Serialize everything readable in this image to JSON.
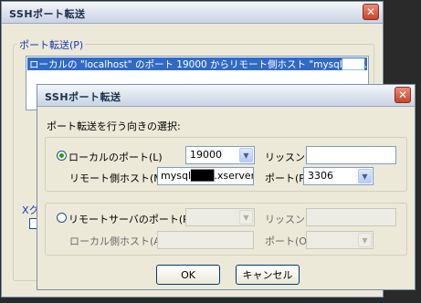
{
  "back_dialog": {
    "title": "SSHポート転送",
    "close_glyph": "✕",
    "group_label": "ポート転送(P)",
    "list_items": [
      "ローカルの \"localhost\" のポート 19000 からリモート側ホスト \"mysql███.xserver."
    ],
    "cropped_label": "Xク"
  },
  "dialog": {
    "title": "SSHポート転送",
    "close_glyph": "✕",
    "prompt": "ポート転送を行う向きの選択:",
    "local": {
      "radio_label": "ローカルのポート(L)",
      "port_value": "19000",
      "listen_label": "リッスン(I)",
      "listen_value": "",
      "remote_host_label": "リモート側ホスト(M)",
      "remote_host_value": "mysql███.xserver.jp",
      "port_label": "ポート(P)",
      "port_select_value": "3306"
    },
    "remote": {
      "radio_label": "リモートサーバのポート(R)",
      "port_value": "",
      "listen_label": "リッスン(S)",
      "listen_value": "",
      "local_host_label": "ローカル側ホスト(A)",
      "local_host_value": "",
      "port_label": "ポート(O)",
      "port_select_value": ""
    },
    "ok_label": "OK",
    "cancel_label": "キャンセル"
  },
  "icons": {
    "dropdown_arrow": "▼"
  }
}
